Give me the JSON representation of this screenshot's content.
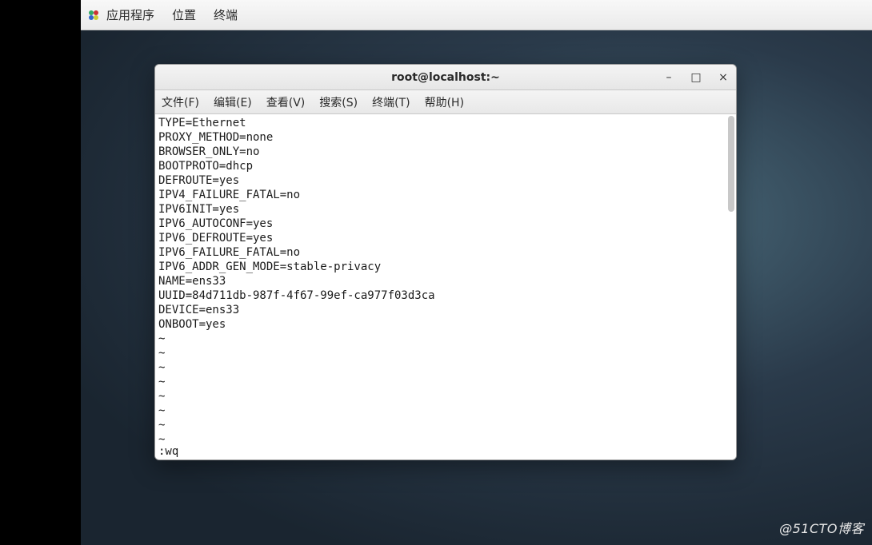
{
  "top_panel": {
    "items": [
      "应用程序",
      "位置",
      "终端"
    ]
  },
  "window": {
    "title": "root@localhost:~",
    "controls": {
      "minimize": "–",
      "maximize": "□",
      "close": "×"
    },
    "menubar": [
      "文件(F)",
      "编辑(E)",
      "查看(V)",
      "搜索(S)",
      "终端(T)",
      "帮助(H)"
    ]
  },
  "terminal": {
    "lines": [
      "TYPE=Ethernet",
      "PROXY_METHOD=none",
      "BROWSER_ONLY=no",
      "BOOTPROTO=dhcp",
      "DEFROUTE=yes",
      "IPV4_FAILURE_FATAL=no",
      "IPV6INIT=yes",
      "IPV6_AUTOCONF=yes",
      "IPV6_DEFROUTE=yes",
      "IPV6_FAILURE_FATAL=no",
      "IPV6_ADDR_GEN_MODE=stable-privacy",
      "NAME=ens33",
      "UUID=84d711db-987f-4f67-99ef-ca977f03d3ca",
      "DEVICE=ens33",
      "ONBOOT=yes"
    ],
    "tilde": "~",
    "tilde_count": 8,
    "command": ":wq"
  },
  "watermark": "@51CTO博客"
}
